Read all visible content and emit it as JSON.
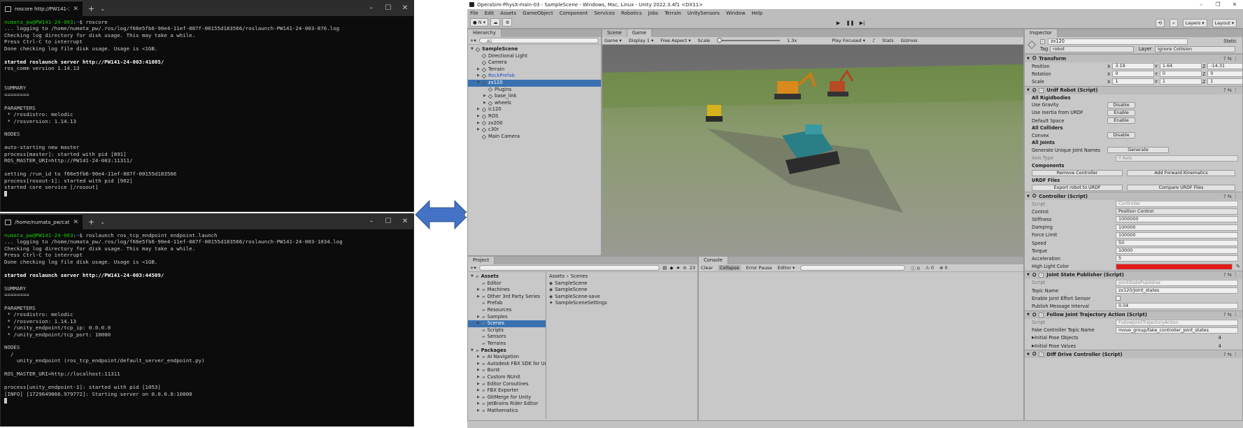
{
  "term1": {
    "tab": "roscore http://PW141-24-003:1",
    "lines": [
      [
        {
          "t": "numata_pw@PW141-24-003",
          "c": "g"
        },
        {
          "t": ":",
          "c": "d"
        },
        {
          "t": "~",
          "c": "b"
        },
        {
          "t": "$ roscore",
          "c": "d"
        }
      ],
      [
        {
          "t": "... logging to /home/numata_pw/.ros/log/f66e5fb6-90e4-11ef-887f-00155d183566/roslaunch-PW141-24-003-876.log",
          "c": "d"
        }
      ],
      [
        {
          "t": "Checking log directory for disk usage. This may take a while.",
          "c": "d"
        }
      ],
      [
        {
          "t": "Press Ctrl-C to interrupt",
          "c": "d"
        }
      ],
      [
        {
          "t": "Done checking log file disk usage. Usage is <1GB.",
          "c": "d"
        }
      ],
      [
        {
          "t": "",
          "c": "d"
        }
      ],
      [
        {
          "t": "started roslaunch server http://PW141-24-003:41085/",
          "c": "w"
        }
      ],
      [
        {
          "t": "ros_comm version 1.14.13",
          "c": "d"
        }
      ],
      [
        {
          "t": "",
          "c": "d"
        }
      ],
      [
        {
          "t": "",
          "c": "d"
        }
      ],
      [
        {
          "t": "SUMMARY",
          "c": "d"
        }
      ],
      [
        {
          "t": "========",
          "c": "d"
        }
      ],
      [
        {
          "t": "",
          "c": "d"
        }
      ],
      [
        {
          "t": "PARAMETERS",
          "c": "d"
        }
      ],
      [
        {
          "t": " * /rosdistro: melodic",
          "c": "d"
        }
      ],
      [
        {
          "t": " * /rosversion: 1.14.13",
          "c": "d"
        }
      ],
      [
        {
          "t": "",
          "c": "d"
        }
      ],
      [
        {
          "t": "NODES",
          "c": "d"
        }
      ],
      [
        {
          "t": "",
          "c": "d"
        }
      ],
      [
        {
          "t": "auto-starting new master",
          "c": "d"
        }
      ],
      [
        {
          "t": "process[master]: started with pid [891]",
          "c": "d"
        }
      ],
      [
        {
          "t": "ROS_MASTER_URI=http://PW141-24-003:11311/",
          "c": "d"
        }
      ],
      [
        {
          "t": "",
          "c": "d"
        }
      ],
      [
        {
          "t": "setting /run_id to f66e5fb6-90e4-11ef-887f-00155d183566",
          "c": "d"
        }
      ],
      [
        {
          "t": "process[rosout-1]: started with pid [902]",
          "c": "d"
        }
      ],
      [
        {
          "t": "started core service [/rosout]",
          "c": "d"
        }
      ]
    ]
  },
  "term2": {
    "tab": "/home/numata_pw/catkin_ws",
    "lines": [
      [
        {
          "t": "numata_pw@PW141-24-003",
          "c": "g"
        },
        {
          "t": ":",
          "c": "d"
        },
        {
          "t": "~",
          "c": "b"
        },
        {
          "t": "$ roslaunch ros_tcp_endpoint endpoint.launch",
          "c": "d"
        }
      ],
      [
        {
          "t": "... logging to /home/numata_pw/.ros/log/f66e5fb6-90e4-11ef-887f-00155d183566/roslaunch-PW141-24-003-1034.log",
          "c": "d"
        }
      ],
      [
        {
          "t": "Checking log directory for disk usage. This may take a while.",
          "c": "d"
        }
      ],
      [
        {
          "t": "Press Ctrl-C to interrupt",
          "c": "d"
        }
      ],
      [
        {
          "t": "Done checking log file disk usage. Usage is <1GB.",
          "c": "d"
        }
      ],
      [
        {
          "t": "",
          "c": "d"
        }
      ],
      [
        {
          "t": "started roslaunch server http://PW141-24-003:44509/",
          "c": "w"
        }
      ],
      [
        {
          "t": "",
          "c": "d"
        }
      ],
      [
        {
          "t": "SUMMARY",
          "c": "d"
        }
      ],
      [
        {
          "t": "========",
          "c": "d"
        }
      ],
      [
        {
          "t": "",
          "c": "d"
        }
      ],
      [
        {
          "t": "PARAMETERS",
          "c": "d"
        }
      ],
      [
        {
          "t": " * /rosdistro: melodic",
          "c": "d"
        }
      ],
      [
        {
          "t": " * /rosversion: 1.14.13",
          "c": "d"
        }
      ],
      [
        {
          "t": " * /unity_endpoint/tcp_ip: 0.0.0.0",
          "c": "d"
        }
      ],
      [
        {
          "t": " * /unity_endpoint/tcp_port: 10000",
          "c": "d"
        }
      ],
      [
        {
          "t": "",
          "c": "d"
        }
      ],
      [
        {
          "t": "NODES",
          "c": "d"
        }
      ],
      [
        {
          "t": "  /",
          "c": "d"
        }
      ],
      [
        {
          "t": "    unity_endpoint (ros_tcp_endpoint/default_server_endpoint.py)",
          "c": "d"
        }
      ],
      [
        {
          "t": "",
          "c": "d"
        }
      ],
      [
        {
          "t": "ROS_MASTER_URI=http://localhost:11311",
          "c": "d"
        }
      ],
      [
        {
          "t": "",
          "c": "d"
        }
      ],
      [
        {
          "t": "process[unity_endpoint-1]: started with pid [1053]",
          "c": "d"
        }
      ],
      [
        {
          "t": "[INFO] [1729649866.979772]: Starting server on 0.0.0.0:10000",
          "c": "d"
        }
      ]
    ]
  },
  "unity": {
    "title": "OperaSim-PhysX-main-03 - SampleScene - Windows, Mac, Linux - Unity 2022.3.4f1 <DX11>",
    "menu": [
      "File",
      "Edit",
      "Assets",
      "GameObject",
      "Component",
      "Services",
      "Robotics",
      "Jobs",
      "Terrain",
      "UnitySensors",
      "Window",
      "Help"
    ],
    "toolbar": {
      "account": "N",
      "layers": "Layers",
      "layout": "Layout"
    },
    "hierarchy": {
      "tab": "Hierarchy",
      "search": "All",
      "items": [
        {
          "label": "SampleScene",
          "depth": 0,
          "arrow": "▼",
          "bold": true
        },
        {
          "label": "Directional Light",
          "depth": 1,
          "arrow": ""
        },
        {
          "label": "Camera",
          "depth": 1,
          "arrow": ""
        },
        {
          "label": "Terrain",
          "depth": 1,
          "arrow": "▶"
        },
        {
          "label": "RockPrefab",
          "depth": 1,
          "arrow": "▶",
          "blue": true
        },
        {
          "label": "zx120",
          "depth": 1,
          "arrow": "▼",
          "sel": true
        },
        {
          "label": "Plugins",
          "depth": 2,
          "arrow": ""
        },
        {
          "label": "base_link",
          "depth": 2,
          "arrow": "▶"
        },
        {
          "label": "wheels",
          "depth": 2,
          "arrow": "▶"
        },
        {
          "label": "ic120",
          "depth": 1,
          "arrow": "▶"
        },
        {
          "label": "ROS",
          "depth": 1,
          "arrow": "▶"
        },
        {
          "label": "zx200",
          "depth": 1,
          "arrow": "▶"
        },
        {
          "label": "c30r",
          "depth": 1,
          "arrow": "▶"
        },
        {
          "label": "Main Camera",
          "depth": 1,
          "arrow": ""
        }
      ]
    },
    "view": {
      "tabs": [
        "Scene",
        "Game"
      ],
      "game_label": "Game",
      "display": "Display 1",
      "aspect": "Free Aspect",
      "scale_label": "Scale",
      "scale_value": "1.3x",
      "play_focused": "Play Focused",
      "stats": "Stats",
      "gizmos": "Gizmos"
    },
    "project": {
      "tab": "Project",
      "count": "23",
      "breadcrumb": [
        "Assets",
        "Scenes"
      ],
      "tree": [
        {
          "label": "Assets",
          "depth": 0,
          "arrow": "▼",
          "bold": true
        },
        {
          "label": "Editor",
          "depth": 1,
          "arrow": ""
        },
        {
          "label": "Machines",
          "depth": 1,
          "arrow": "▶"
        },
        {
          "label": "Other 3rd Party Series",
          "depth": 1,
          "arrow": "▶"
        },
        {
          "label": "Prefab",
          "depth": 1,
          "arrow": ""
        },
        {
          "label": "Resources",
          "depth": 1,
          "arrow": ""
        },
        {
          "label": "Samples",
          "depth": 1,
          "arrow": "▶"
        },
        {
          "label": "Scenes",
          "depth": 1,
          "arrow": "▶",
          "sel": true
        },
        {
          "label": "Scripts",
          "depth": 1,
          "arrow": ""
        },
        {
          "label": "Sensors",
          "depth": 1,
          "arrow": ""
        },
        {
          "label": "Terrains",
          "depth": 1,
          "arrow": ""
        },
        {
          "label": "Packages",
          "depth": 0,
          "arrow": "▼",
          "bold": true
        },
        {
          "label": "AI Navigation",
          "depth": 1,
          "arrow": "▶"
        },
        {
          "label": "Autodesk FBX SDK for Un",
          "depth": 1,
          "arrow": "▶"
        },
        {
          "label": "Burst",
          "depth": 1,
          "arrow": "▶"
        },
        {
          "label": "Custom NUnit",
          "depth": 1,
          "arrow": "▶"
        },
        {
          "label": "Editor Coroutines",
          "depth": 1,
          "arrow": "▶"
        },
        {
          "label": "FBX Exporter",
          "depth": 1,
          "arrow": "▶"
        },
        {
          "label": "GitMerge for Unity",
          "depth": 1,
          "arrow": "▶"
        },
        {
          "label": "JetBrains Rider Editor",
          "depth": 1,
          "arrow": "▶"
        },
        {
          "label": "Mathematics",
          "depth": 1,
          "arrow": "▶"
        }
      ],
      "files": [
        "SampleScene",
        "SampleScene",
        "SampleScene-save",
        "SampleSceneSettings"
      ]
    },
    "console": {
      "tab": "Console",
      "clear": "Clear",
      "collapse": "Collapse",
      "error_pause": "Error Pause",
      "editor": "Editor",
      "counts": [
        "0",
        "0",
        "0"
      ]
    },
    "inspector": {
      "tab": "Inspector",
      "object_name": "zx120",
      "static_label": "Static",
      "tag_label": "Tag",
      "tag_value": "robot",
      "layer_label": "Layer",
      "layer_value": "Ignore Collision",
      "transform": {
        "title": "Transform",
        "rows": [
          {
            "label": "Position",
            "x": "3.19",
            "y": "1.64",
            "z": "-14.31"
          },
          {
            "label": "Rotation",
            "x": "0",
            "y": "0",
            "z": "0"
          },
          {
            "label": "Scale",
            "x": "1",
            "y": "1",
            "z": "1"
          }
        ]
      },
      "urdf": {
        "title": "Urdf Robot (Script)",
        "all_rigidbodies": "All Rigidbodies",
        "use_gravity": "Use Gravity",
        "use_inertia": "Use Inertia from URDF",
        "default_space": "Default Space",
        "disable": "Disable",
        "enable": "Enable",
        "all_colliders": "All Colliders",
        "convex": "Convex",
        "all_joints": "All Joints",
        "gen_names": "Generate Unique Joint Names",
        "generate": "Generate",
        "axis_type": "Axis Type",
        "axis_value": "Y Axis",
        "components": "Components",
        "remove_controller": "Remove Controller",
        "add_fk": "Add Forward Kinematics",
        "urdf_files": "URDF Files",
        "export": "Export robot to URDF",
        "compare": "Compare URDF Files"
      },
      "controller": {
        "title": "Controller (Script)",
        "rows": [
          {
            "label": "Script",
            "value": "Controller",
            "dim": true
          },
          {
            "label": "Control",
            "value": "Position Control"
          },
          {
            "label": "Stiffness",
            "value": "1000000"
          },
          {
            "label": "Damping",
            "value": "100000"
          },
          {
            "label": "Force Limit",
            "value": "100000"
          },
          {
            "label": "Speed",
            "value": "50"
          },
          {
            "label": "Torque",
            "value": "10000"
          },
          {
            "label": "Acceleration",
            "value": "5"
          }
        ],
        "highlight_label": "High Light Color",
        "highlight_color": "#e11a1a"
      },
      "jsp": {
        "title": "Joint State Publisher (Script)",
        "rows": [
          {
            "label": "Script",
            "value": "JointStatePublisher",
            "dim": true
          },
          {
            "label": "Topic Name",
            "value": "zx120/joint_states"
          },
          {
            "label": "Enable Joint Effort Sensor",
            "value": ""
          },
          {
            "label": "Publish Message Interval",
            "value": "0.04"
          }
        ]
      },
      "fjt": {
        "title": "Follow Joint Trajectory Action (Script)",
        "rows": [
          {
            "label": "Script",
            "value": "FollowJointTrajectoryAction",
            "dim": true
          },
          {
            "label": "Fake Controller Topic Name",
            "value": "move_group/fake_controller_joint_states"
          }
        ],
        "initial_pose_objects": "Initial Pose Objects",
        "initial_pose_objects_count": "4",
        "initial_pose_values": "Initial Pose Values",
        "initial_pose_values_count": "4"
      },
      "ddc": {
        "title": "Diff Drive Controller (Script)"
      }
    }
  }
}
